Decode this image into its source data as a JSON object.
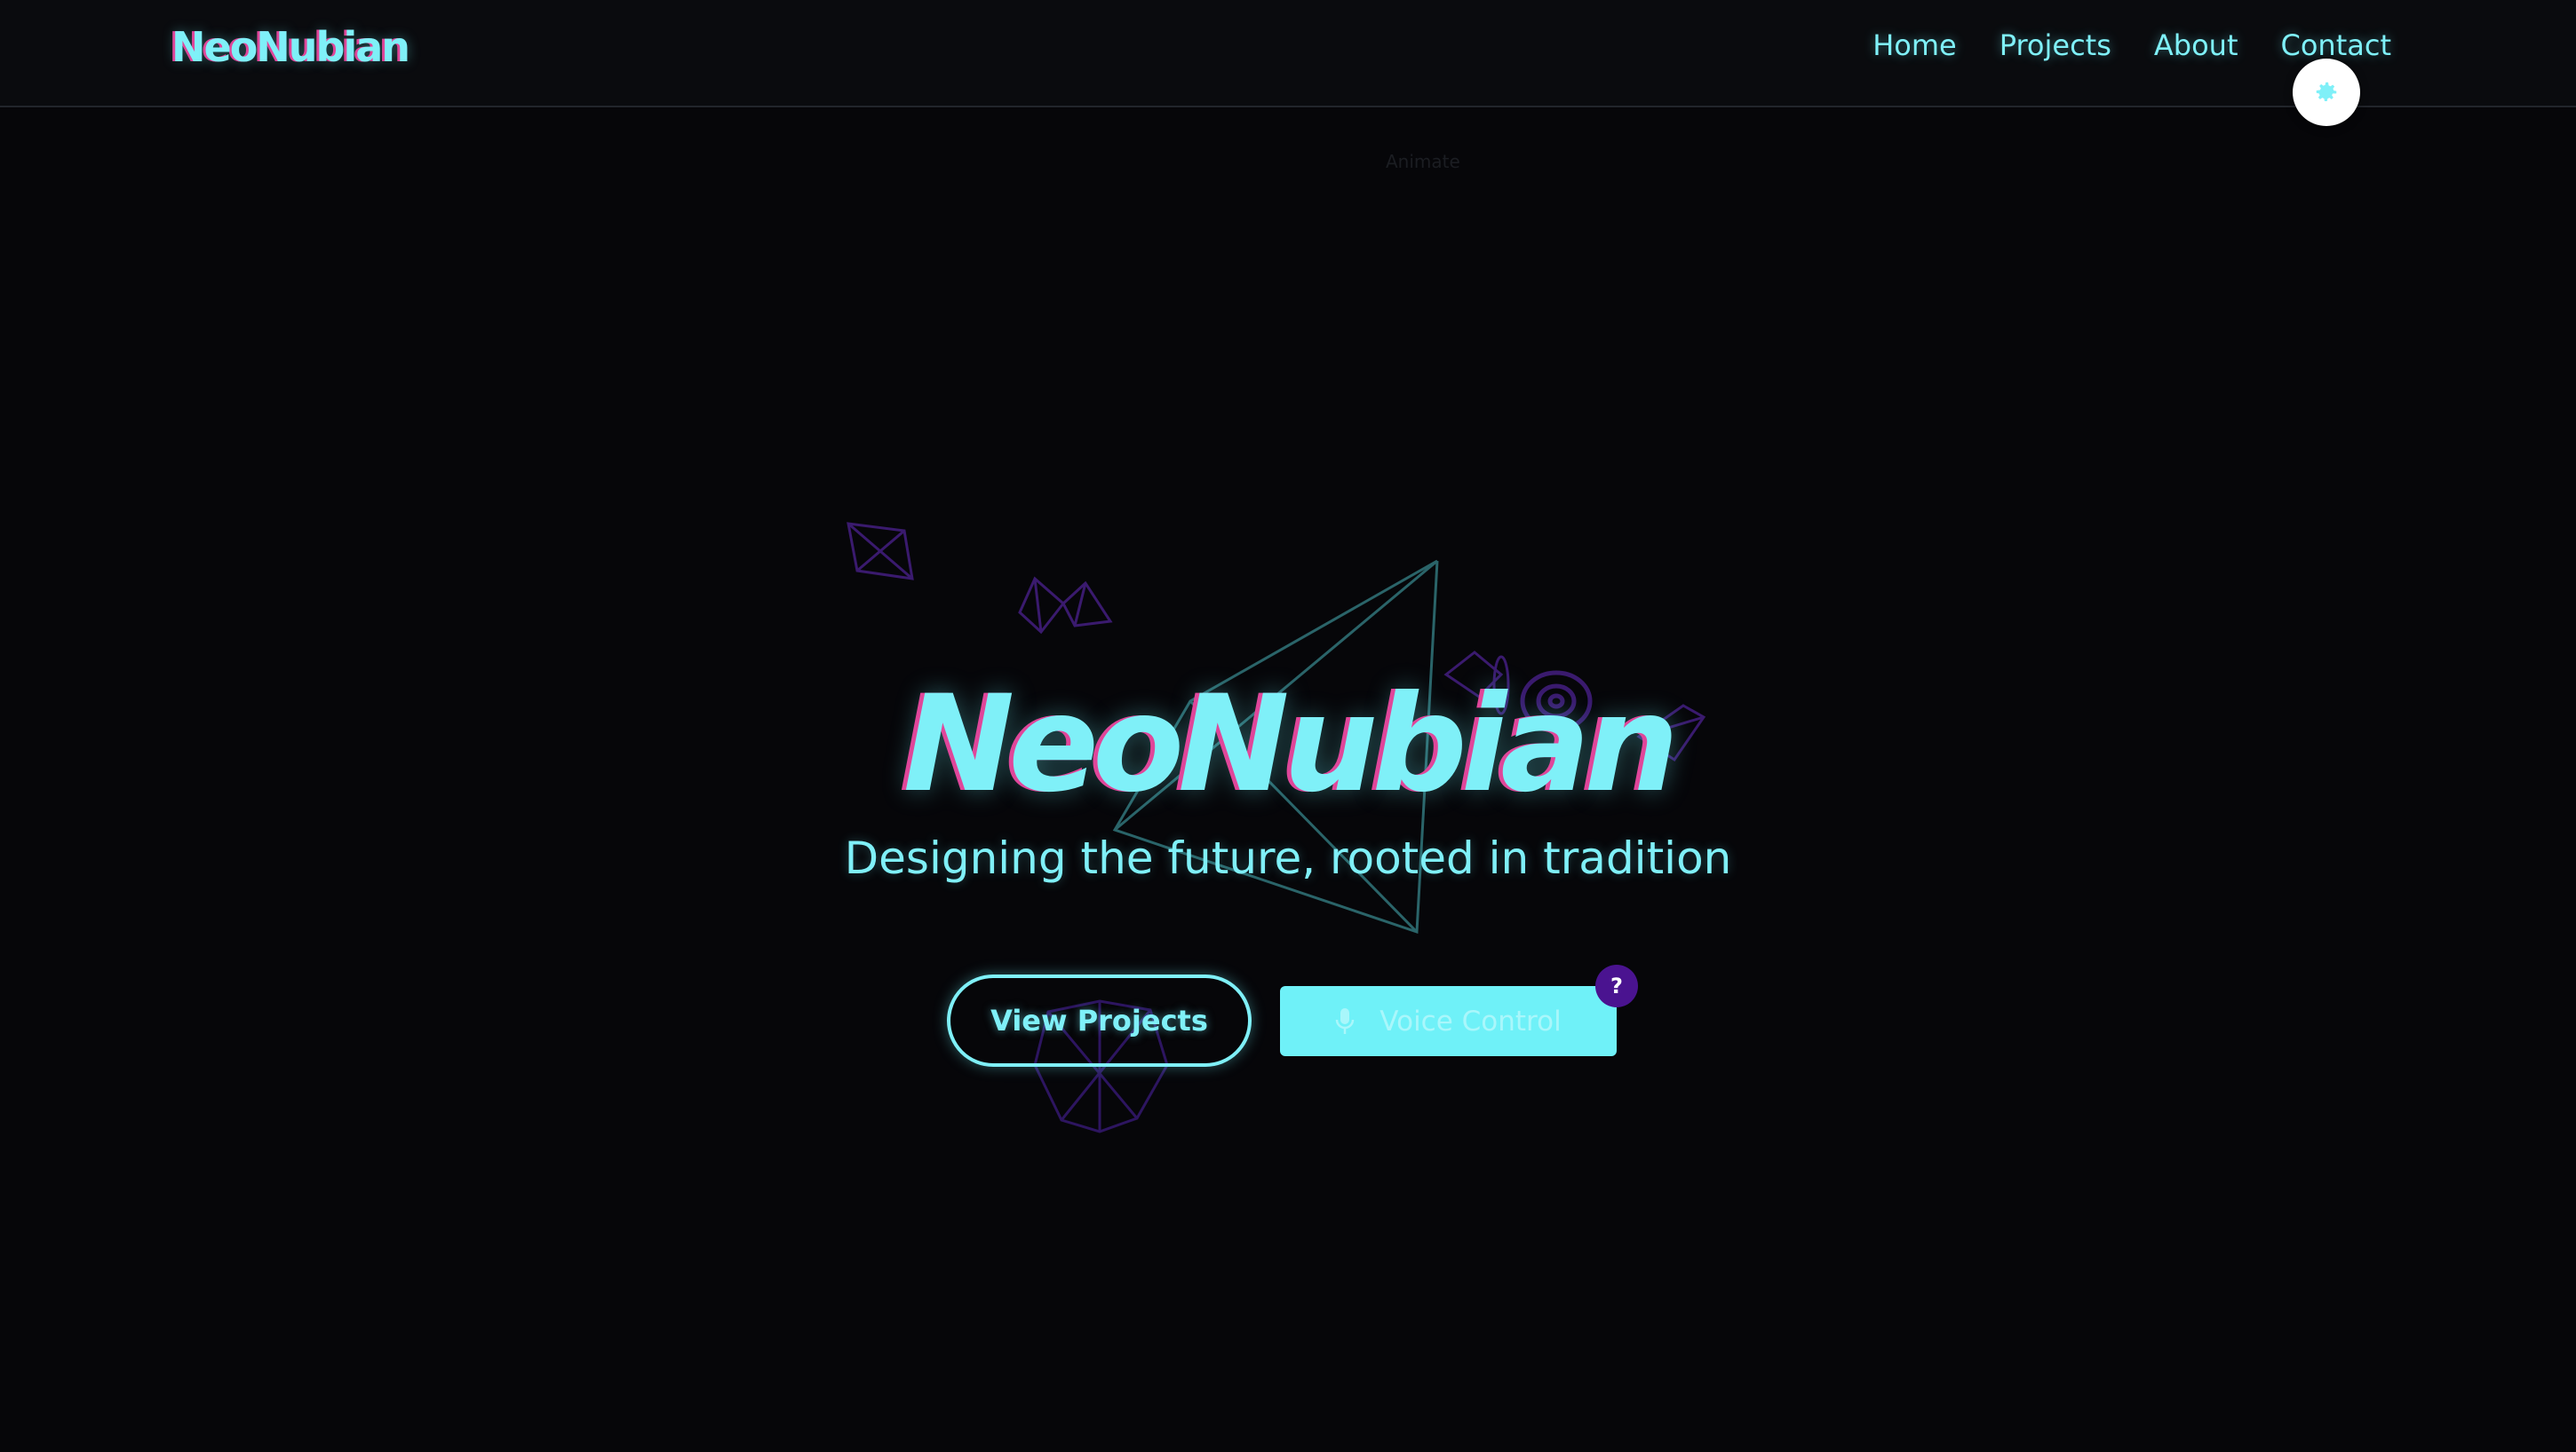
{
  "header": {
    "logo": "NeoNubian",
    "nav": [
      {
        "label": "Home"
      },
      {
        "label": "Projects"
      },
      {
        "label": "About"
      },
      {
        "label": "Contact"
      }
    ],
    "settings_icon": "gear-icon"
  },
  "faint_label": "Animate",
  "hero": {
    "title": "NeoNubian",
    "subtitle": "Designing the future, rooted in tradition",
    "view_projects_label": "View Projects",
    "voice_control_label": "Voice Control",
    "voice_icon": "microphone-icon",
    "help_label": "?"
  },
  "colors": {
    "background": "#060609",
    "header_bg": "#0a0b0e",
    "accent_cyan": "#7ff0f8",
    "accent_pink": "#e0469a",
    "help_badge": "#4a1390",
    "deco_purple": "#3a1a6e",
    "deco_teal": "#2f6f74"
  }
}
